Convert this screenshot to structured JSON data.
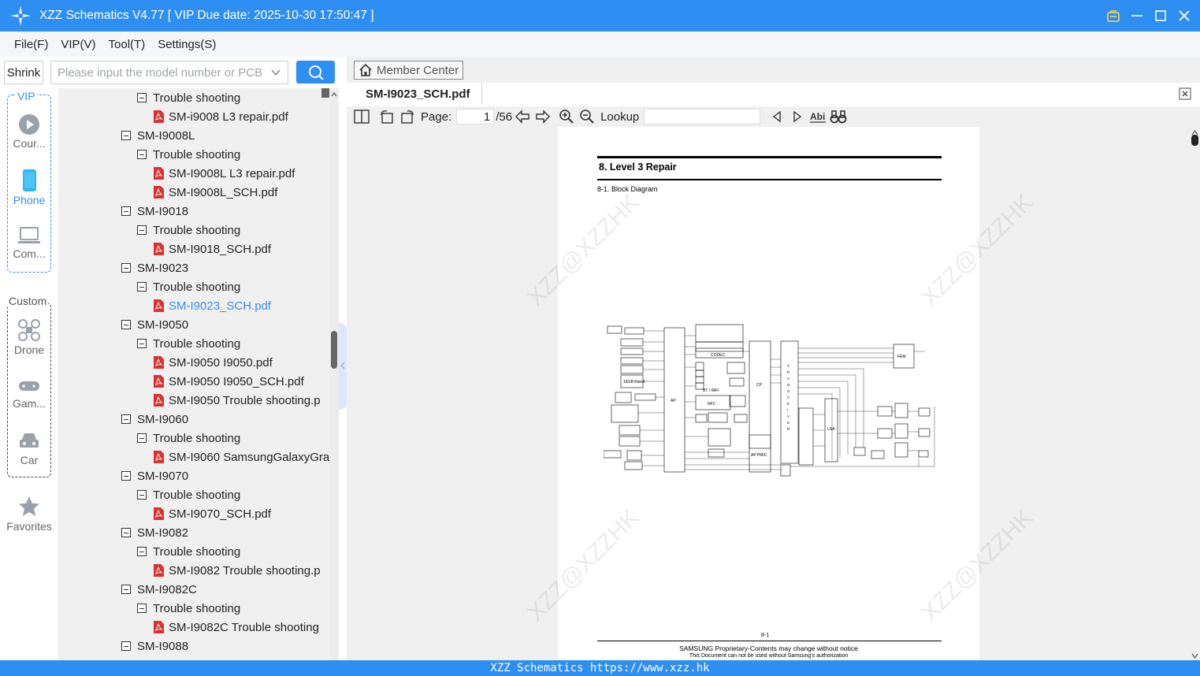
{
  "app": {
    "title": "XZZ Schematics V4.77 [ VIP Due date: 2025-10-30 17:50:47 ]"
  },
  "menu": {
    "file": "File(F)",
    "vip": "VIP(V)",
    "tool": "Tool(T)",
    "settings": "Settings(S)"
  },
  "sidebar": {
    "shrink": "Shrink",
    "vip_label": "VIP",
    "custom_label": "Custom",
    "vip_items": [
      {
        "label": "Cour...",
        "icon": "play-circle-icon"
      },
      {
        "label": "Phone",
        "icon": "phone-icon"
      },
      {
        "label": "Com...",
        "icon": "laptop-icon"
      }
    ],
    "custom_items": [
      {
        "label": "Drone",
        "icon": "drone-icon"
      },
      {
        "label": "Gam...",
        "icon": "gamepad-icon"
      },
      {
        "label": "Car",
        "icon": "car-icon"
      }
    ],
    "favorites": "Favorites"
  },
  "search": {
    "placeholder": "Please input the model number or PCB"
  },
  "tree": [
    {
      "level": 1,
      "label": "Trouble shooting",
      "type": "folder"
    },
    {
      "level": 2,
      "label": "SM-i9008 L3 repair.pdf",
      "type": "pdf"
    },
    {
      "level": 0,
      "label": "SM-I9008L",
      "type": "folder"
    },
    {
      "level": 1,
      "label": "Trouble shooting",
      "type": "folder"
    },
    {
      "level": 2,
      "label": "SM-I9008L L3 repair.pdf",
      "type": "pdf"
    },
    {
      "level": 2,
      "label": "SM-I9008L_SCH.pdf",
      "type": "pdf"
    },
    {
      "level": 0,
      "label": "SM-I9018",
      "type": "folder"
    },
    {
      "level": 1,
      "label": "Trouble shooting",
      "type": "folder"
    },
    {
      "level": 2,
      "label": "SM-I9018_SCH.pdf",
      "type": "pdf"
    },
    {
      "level": 0,
      "label": "SM-I9023",
      "type": "folder"
    },
    {
      "level": 1,
      "label": "Trouble shooting",
      "type": "folder"
    },
    {
      "level": 2,
      "label": "SM-I9023_SCH.pdf",
      "type": "pdf",
      "selected": true
    },
    {
      "level": 0,
      "label": "SM-I9050",
      "type": "folder"
    },
    {
      "level": 1,
      "label": "Trouble shooting",
      "type": "folder"
    },
    {
      "level": 2,
      "label": "SM-I9050 I9050.pdf",
      "type": "pdf"
    },
    {
      "level": 2,
      "label": "SM-I9050 I9050_SCH.pdf",
      "type": "pdf"
    },
    {
      "level": 2,
      "label": "SM-I9050 Trouble shooting.p",
      "type": "pdf"
    },
    {
      "level": 0,
      "label": "SM-I9060",
      "type": "folder"
    },
    {
      "level": 1,
      "label": "Trouble shooting",
      "type": "folder"
    },
    {
      "level": 2,
      "label": "SM-I9060 SamsungGalaxyGra",
      "type": "pdf"
    },
    {
      "level": 0,
      "label": "SM-I9070",
      "type": "folder"
    },
    {
      "level": 1,
      "label": "Trouble shooting",
      "type": "folder"
    },
    {
      "level": 2,
      "label": "SM-I9070_SCH.pdf",
      "type": "pdf"
    },
    {
      "level": 0,
      "label": "SM-I9082",
      "type": "folder"
    },
    {
      "level": 1,
      "label": "Trouble shooting",
      "type": "folder"
    },
    {
      "level": 2,
      "label": "SM-I9082 Trouble shooting.p",
      "type": "pdf"
    },
    {
      "level": 0,
      "label": "SM-I9082C",
      "type": "folder"
    },
    {
      "level": 1,
      "label": "Trouble shooting",
      "type": "folder"
    },
    {
      "level": 2,
      "label": "SM-I9082C Trouble shooting",
      "type": "pdf"
    },
    {
      "level": 0,
      "label": "SM-I9088",
      "type": "folder"
    }
  ],
  "viewer": {
    "member_center": "Member Center",
    "tab": "SM-I9023_SCH.pdf",
    "page_label": "Page:",
    "page_current": "1",
    "page_total": "/56",
    "lookup_label": "Lookup",
    "lookup_value": ""
  },
  "pdf": {
    "heading": "8.  Level  3  Repair",
    "subheading": "8-1.  Block  Diagram",
    "page_number": "8-1",
    "footer1": "SAMSUNG Proprietary-Contents may change without notice",
    "footer2": "This Document can not be used without Samsung's authorization",
    "watermark": "XZZ@XZZHK",
    "diagram_labels": {
      "ap": "AP",
      "cp": "CP",
      "ap_pmic": "AP PMIC",
      "codec": "CODEC",
      "nfc": "NFC",
      "bt_wifi": "BT / WiFi",
      "nand": "16GB iNand",
      "transceiver": "TRANSCEIVER",
      "fem": "FEM",
      "lna": "LNA"
    }
  },
  "status": {
    "text": "XZZ Schematics https://www.xzz.hk"
  },
  "colors": {
    "accent": "#2f8ef2",
    "selected_text": "#3b8ee8",
    "pdf_red": "#d93232"
  }
}
